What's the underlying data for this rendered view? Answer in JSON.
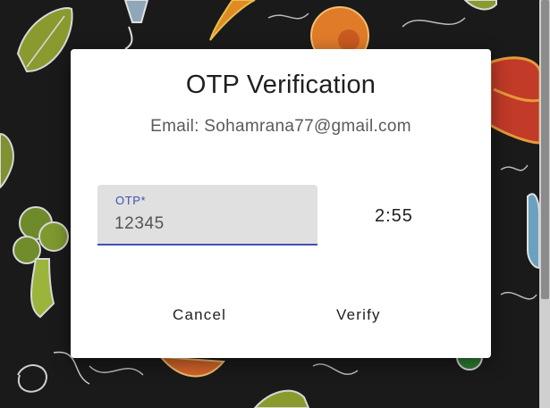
{
  "dialog": {
    "title": "OTP Verification",
    "email_line": "Email: Sohamrana77@gmail.com",
    "otp_field": {
      "label": "OTP*",
      "value": "12345"
    },
    "timer": "2:55",
    "actions": {
      "cancel_label": "Cancel",
      "verify_label": "Verify"
    }
  },
  "colors": {
    "backdrop": "#1b1a1a",
    "accent": "#3f51b5",
    "field_bg": "#e0e0e0"
  },
  "background_icons": [
    "leaf-icon",
    "broccoli-icon",
    "peach-icon",
    "carrot-icon",
    "bottle-icon",
    "swirl-icon",
    "tomato-icon"
  ]
}
